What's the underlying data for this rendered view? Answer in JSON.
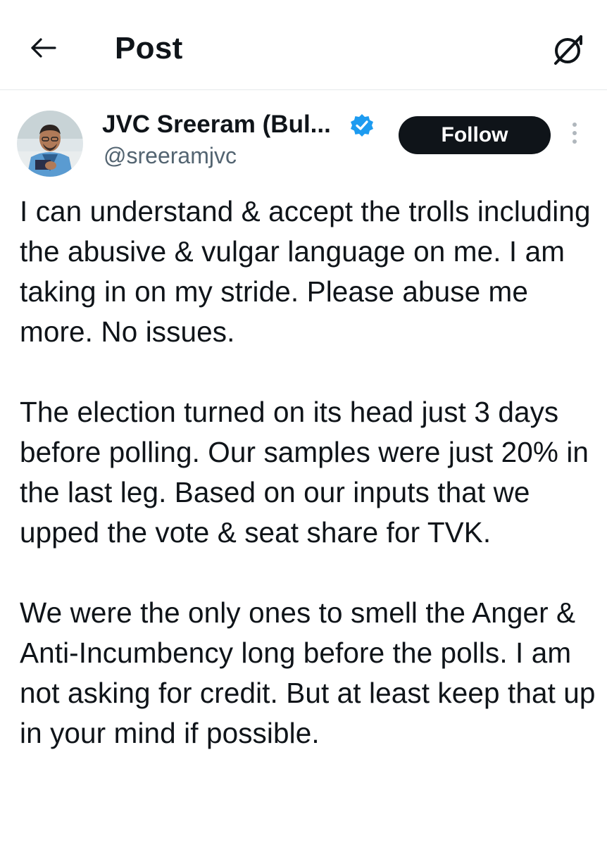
{
  "header": {
    "back_icon": "arrow-left-icon",
    "title": "Post",
    "grok_icon": "grok-icon"
  },
  "post": {
    "author": {
      "display_name": "JVC Sreeram (Bul...",
      "handle": "@sreeramjvc",
      "verified": true,
      "verified_color": "#1d9bf0"
    },
    "follow_label": "Follow",
    "more_icon": "more-vertical-icon",
    "paragraphs": [
      "I can understand & accept the trolls including the abusive & vulgar language on me. I am taking in on my stride. Please abuse me more. No issues.",
      "The election turned on its head just 3 days before polling. Our samples were just 20% in the last leg. Based on our inputs that we upped the vote & seat share for TVK.",
      "We were the only ones to smell the Anger & Anti-Incumbency long before the polls. I am not asking for credit. But at least keep that up in your mind if possible."
    ]
  },
  "colors": {
    "text": "#0f1419",
    "secondary": "#536471",
    "follow_bg": "#0f1419",
    "follow_text": "#ffffff",
    "divider": "#e6e9eb"
  }
}
